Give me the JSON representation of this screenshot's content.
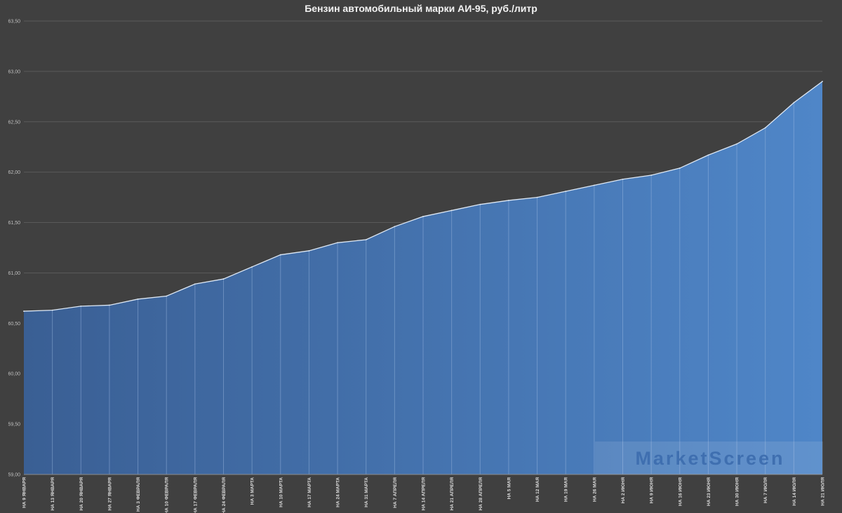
{
  "chart_data": {
    "type": "area",
    "title": "Бензин автомобильный марки АИ-95, руб./литр",
    "xlabel": "",
    "ylabel": "",
    "ylim": [
      59.0,
      63.5
    ],
    "y_ticks": [
      "59,00",
      "59,50",
      "60,00",
      "60,50",
      "61,00",
      "61,50",
      "62,00",
      "62,50",
      "63,00",
      "63,50"
    ],
    "grid": true,
    "legend": "none",
    "categories": [
      "НА 9 ЯНВАРЯ",
      "НА 13 ЯНВАРЯ",
      "НА 20 ЯНВАРЯ",
      "НА 27 ЯНВАРЯ",
      "НА 3 ФЕВРАЛЯ",
      "НА 10 ФЕВРАЛЯ",
      "НА 17 ФЕВРАЛЯ",
      "НА 24 ФЕВРАЛЯ",
      "НА 3 МАРТА",
      "НА 10 МАРТА",
      "НА 17 МАРТА",
      "НА 24 МАРТА",
      "НА 31 МАРТА",
      "НА 7 АПРЕЛЯ",
      "НА 14 АПРЕЛЯ",
      "НА 21 АПРЕЛЯ",
      "НА 28 АПРЕЛЯ",
      "НА 5 МАЯ",
      "НА 12 МАЯ",
      "НА 19 МАЯ",
      "НА 26 МАЯ",
      "НА 2 ИЮНЯ",
      "НА 9 ИЮНЯ",
      "НА 16 ИЮНЯ",
      "НА 23 ИЮНЯ",
      "НА 30 ИЮНЯ",
      "НА 7 ИЮЛЯ",
      "НА 14 ИЮЛЯ",
      "НА 21 ИЮЛЯ"
    ],
    "values": [
      60.62,
      60.63,
      60.67,
      60.68,
      60.74,
      60.77,
      60.89,
      60.94,
      61.06,
      61.18,
      61.22,
      61.3,
      61.33,
      61.46,
      61.56,
      61.62,
      61.68,
      61.72,
      61.75,
      61.81,
      61.87,
      61.93,
      61.97,
      62.04,
      62.17,
      62.28,
      62.44,
      62.69,
      62.9
    ],
    "colors": {
      "area_left": "#3a5f94",
      "area_right": "#4f86c8",
      "line": "#dde8f5",
      "background": "#404040"
    }
  },
  "watermark": {
    "text": "MarketScreen"
  }
}
